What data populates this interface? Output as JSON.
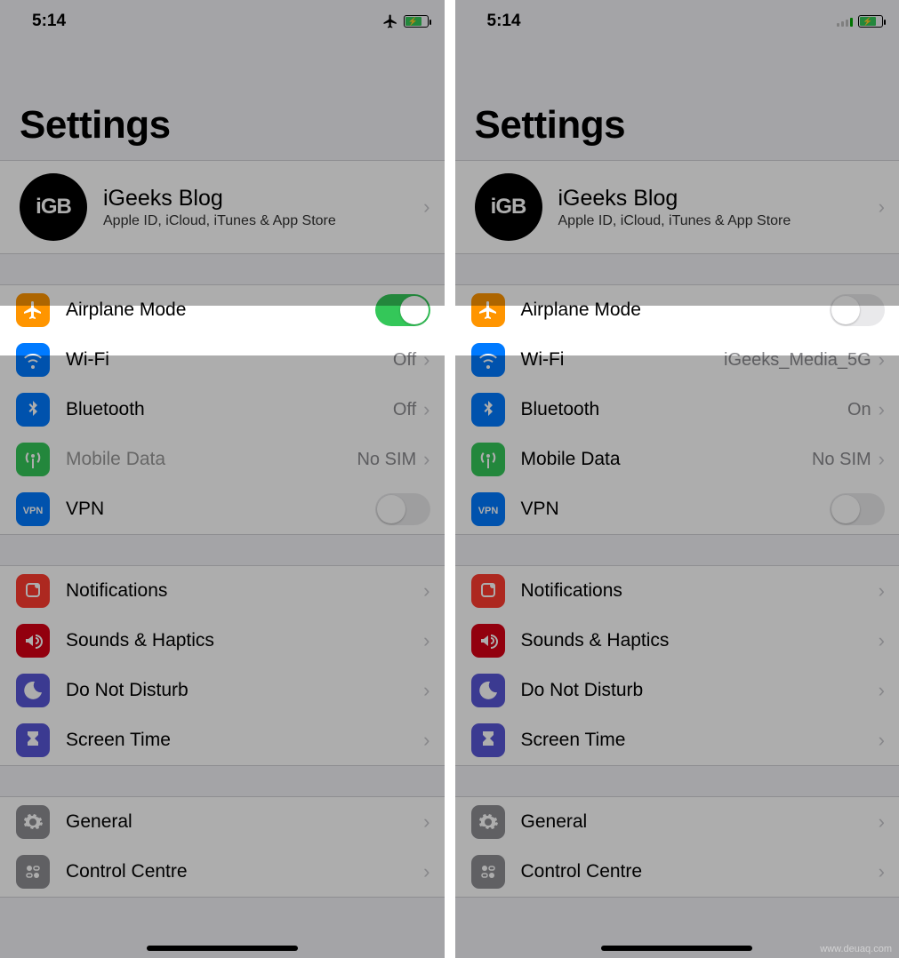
{
  "left": {
    "status": {
      "time": "5:14",
      "airplane_icon": true,
      "battery_charging": true
    },
    "title": "Settings",
    "account": {
      "avatar_text": "iGB",
      "name": "iGeeks Blog",
      "subtitle": "Apple ID, iCloud, iTunes & App Store"
    },
    "highlight": {
      "label": "Airplane Mode",
      "toggle_on": true
    },
    "net_rows": [
      {
        "icon": "wifi",
        "color": "bg-blue",
        "label": "Wi-Fi",
        "value": "Off",
        "chevron": true
      },
      {
        "icon": "bluetooth",
        "color": "bg-blue",
        "label": "Bluetooth",
        "value": "Off",
        "chevron": true
      },
      {
        "icon": "antenna",
        "color": "bg-green",
        "label": "Mobile Data",
        "value": "No SIM",
        "chevron": true,
        "disabled": true
      },
      {
        "icon": "vpn",
        "color": "bg-blue",
        "label": "VPN",
        "toggle": "off"
      }
    ],
    "group2": [
      {
        "icon": "bell",
        "color": "bg-red",
        "label": "Notifications"
      },
      {
        "icon": "speaker",
        "color": "bg-crimson",
        "label": "Sounds & Haptics"
      },
      {
        "icon": "moon",
        "color": "bg-indigo",
        "label": "Do Not Disturb"
      },
      {
        "icon": "hourglass",
        "color": "bg-indigo",
        "label": "Screen Time"
      }
    ],
    "group3": [
      {
        "icon": "gear",
        "color": "bg-gray",
        "label": "General"
      },
      {
        "icon": "control",
        "color": "bg-gray",
        "label": "Control Centre"
      }
    ]
  },
  "right": {
    "status": {
      "time": "5:14",
      "signal_weak": true,
      "battery_charging": true
    },
    "title": "Settings",
    "account": {
      "avatar_text": "iGB",
      "name": "iGeeks Blog",
      "subtitle": "Apple ID, iCloud, iTunes & App Store"
    },
    "highlight": {
      "label": "Airplane Mode",
      "toggle_on": false
    },
    "net_rows": [
      {
        "icon": "wifi",
        "color": "bg-blue",
        "label": "Wi-Fi",
        "value": "iGeeks_Media_5G",
        "chevron": true
      },
      {
        "icon": "bluetooth",
        "color": "bg-blue",
        "label": "Bluetooth",
        "value": "On",
        "chevron": true
      },
      {
        "icon": "antenna",
        "color": "bg-green",
        "label": "Mobile Data",
        "value": "No SIM",
        "chevron": true
      },
      {
        "icon": "vpn",
        "color": "bg-blue",
        "label": "VPN",
        "toggle": "off"
      }
    ],
    "group2": [
      {
        "icon": "bell",
        "color": "bg-red",
        "label": "Notifications"
      },
      {
        "icon": "speaker",
        "color": "bg-crimson",
        "label": "Sounds & Haptics"
      },
      {
        "icon": "moon",
        "color": "bg-indigo",
        "label": "Do Not Disturb"
      },
      {
        "icon": "hourglass",
        "color": "bg-indigo",
        "label": "Screen Time"
      }
    ],
    "group3": [
      {
        "icon": "gear",
        "color": "bg-gray",
        "label": "General"
      },
      {
        "icon": "control",
        "color": "bg-gray",
        "label": "Control Centre"
      }
    ]
  },
  "watermark": "www.deuaq.com"
}
